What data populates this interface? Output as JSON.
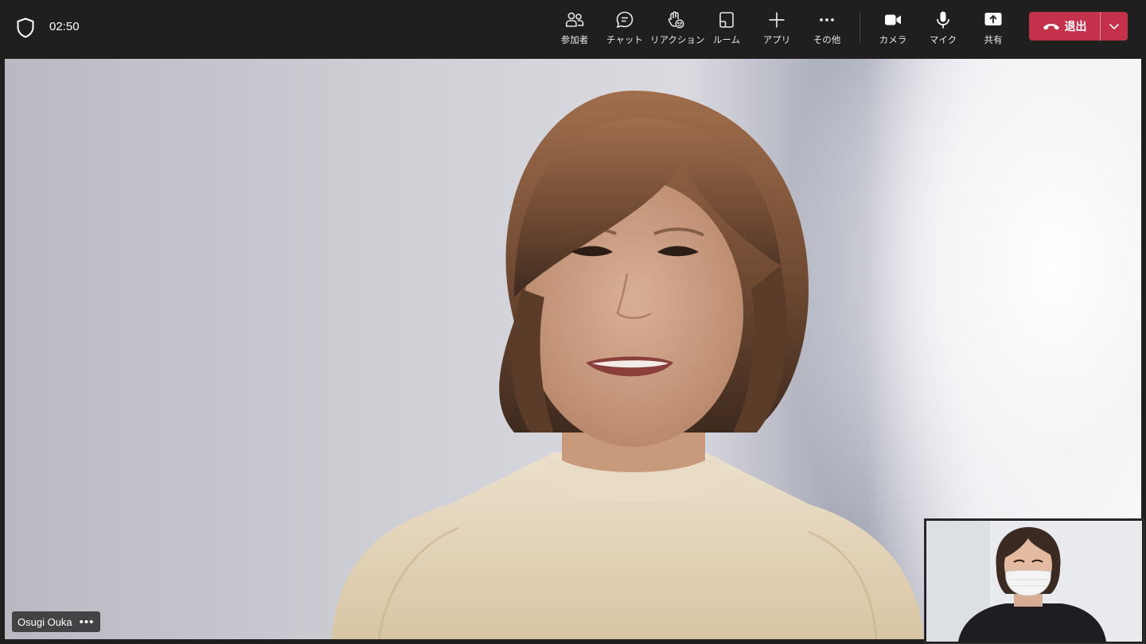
{
  "meeting": {
    "timer": "02:50"
  },
  "toolbar": {
    "participants_label": "参加者",
    "chat_label": "チャット",
    "reactions_label": "リアクション",
    "rooms_label": "ルーム",
    "apps_label": "アプリ",
    "more_label": "その他",
    "camera_label": "カメラ",
    "mic_label": "マイク",
    "share_label": "共有",
    "leave_label": "退出"
  },
  "main_video": {
    "participant_name": "Osugi Ouka"
  },
  "colors": {
    "leave": "#c4314b",
    "bar": "#1f1f1f"
  }
}
